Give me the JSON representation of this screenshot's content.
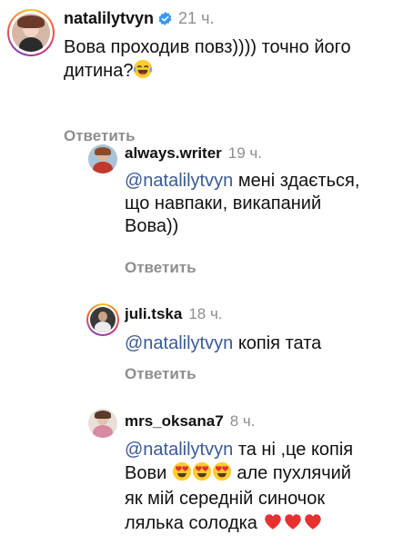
{
  "comments": [
    {
      "username": "natalilytvyn",
      "verified": true,
      "time": "21 ч.",
      "text": "Вова проходив повз)))) точно його дитина?",
      "emojis_after": [
        "face-with-tears-of-joy"
      ],
      "reply_label": "Ответить"
    },
    {
      "username": "always.writer",
      "time": "19 ч.",
      "mention": "@natalilytvyn",
      "text_lines": [
        "мені здається,",
        "що навпаки, викапаний",
        "Вова))"
      ],
      "reply_label": "Ответить"
    },
    {
      "username": "juli.tska",
      "time": "18 ч.",
      "mention": "@natalilytvyn",
      "text": "копія тата",
      "reply_label": "Ответить"
    },
    {
      "username": "mrs_oksana7",
      "time": "8 ч.",
      "mention": "@natalilytvyn",
      "text_parts": [
        "та ні ,це копія",
        "Вови",
        "але пухлячий",
        "як мій середній синочок",
        "лялька солодка"
      ],
      "emojis_mid": [
        "smiling-face-with-heart-eyes",
        "smiling-face-with-heart-eyes",
        "smiling-face-with-heart-eyes"
      ],
      "emojis_end": [
        "red-heart",
        "red-heart",
        "red-heart"
      ]
    }
  ],
  "colors": {
    "username": "#111111",
    "timestamp": "#8e8e8e",
    "mention": "#3a5a97",
    "verified": "#3897f0"
  }
}
